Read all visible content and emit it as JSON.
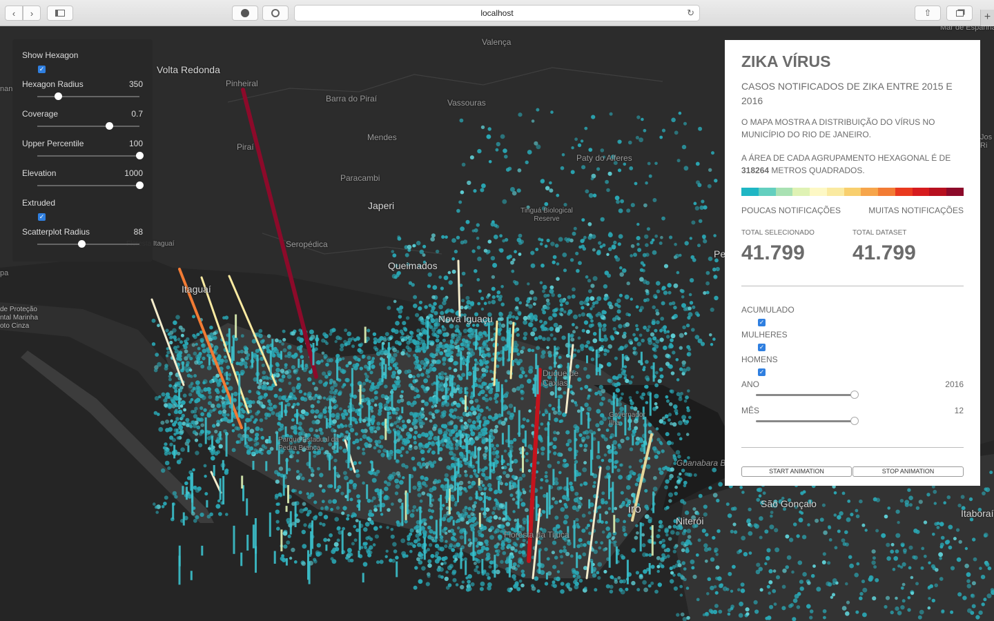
{
  "browser": {
    "url": "localhost"
  },
  "map": {
    "places": [
      {
        "name": "Valença"
      },
      {
        "name": "Volta Redonda"
      },
      {
        "name": "Pinheiral"
      },
      {
        "name": "Barra do Piraí"
      },
      {
        "name": "Vassouras"
      },
      {
        "name": "Mendes"
      },
      {
        "name": "Piraí"
      },
      {
        "name": "Paty do Alferes"
      },
      {
        "name": "Paracambi"
      },
      {
        "name": "Japeri"
      },
      {
        "name": "Tinguá Biological Reserve"
      },
      {
        "name": "Seropédica"
      },
      {
        "name": "Queimados"
      },
      {
        "name": "Itaguaí"
      },
      {
        "name": "Floresta Itaguaí"
      },
      {
        "name": "Nova Iguaçu"
      },
      {
        "name": "de Proteção ntal Marinha oto Cinza"
      },
      {
        "name": "Parque Estadual da Pedra Branca"
      },
      {
        "name": "Floresta da Tijuca"
      },
      {
        "name": "Niterói"
      },
      {
        "name": "São Gonçalo"
      },
      {
        "name": "Itaboraí"
      },
      {
        "name": "Guanabara B"
      },
      {
        "name": "Mar de Espanha"
      },
      {
        "name": "Pe"
      },
      {
        "name": "Jos Ri"
      },
      {
        "name": "nan"
      },
      {
        "name": "pa"
      },
      {
        "name": "iro"
      },
      {
        "name": "Duque de Caxias"
      },
      {
        "name": "Governador Ilha"
      }
    ]
  },
  "controls": {
    "show_hexagon": {
      "label": "Show Hexagon",
      "checked": true
    },
    "hexagon_radius": {
      "label": "Hexagon Radius",
      "value": "350",
      "fraction": 0.2
    },
    "coverage": {
      "label": "Coverage",
      "value": "0.7",
      "fraction": 0.7
    },
    "upper_percentile": {
      "label": "Upper Percentile",
      "value": "100",
      "fraction": 1.0
    },
    "elevation": {
      "label": "Elevation",
      "value": "1000",
      "fraction": 1.0
    },
    "extruded": {
      "label": "Extruded",
      "checked": true
    },
    "scatterplot_radius": {
      "label": "Scatterplot Radius",
      "value": "88",
      "fraction": 0.43
    }
  },
  "panel": {
    "title": "ZIKA VÍRUS",
    "subtitle": "CASOS NOTIFICADOS DE ZIKA ENTRE 2015 E 2016",
    "description": "O MAPA MOSTRA A DISTRIBUIÇÃO DO VÍRUS NO MUNICÍPIO DO RIO DE JANEIRO.",
    "area_text_before": "A ÁREA DE CADA AGRUPAMENTO HEXAGONAL É DE ",
    "area_value": "318264",
    "area_text_after": " METROS QUADRADOS.",
    "legend_colors": [
      "#1fb6c4",
      "#63cfbf",
      "#a9e1b3",
      "#dff2b4",
      "#fdf8c5",
      "#faeaa1",
      "#f8cf6e",
      "#f6a54b",
      "#f27b34",
      "#e9391e",
      "#d61b1e",
      "#b7101f",
      "#8c0a2a"
    ],
    "legend_low": "POUCAS NOTIFICAÇÕES",
    "legend_high": "MUITAS NOTIFICAÇÕES",
    "total_selected_label": "TOTAL SELECIONADO",
    "total_selected": "41.799",
    "total_dataset_label": "TOTAL DATASET",
    "total_dataset": "41.799",
    "acumulado": {
      "label": "ACUMULADO",
      "checked": true
    },
    "mulheres": {
      "label": "MULHERES",
      "checked": true
    },
    "homens": {
      "label": "HOMENS",
      "checked": true
    },
    "ano": {
      "label": "ANO",
      "value": "2016",
      "fraction": 1.0
    },
    "mes": {
      "label": "MÊS",
      "value": "12",
      "fraction": 1.0
    },
    "start_label": "START ANIMATION",
    "stop_label": "STOP ANIMATION"
  }
}
